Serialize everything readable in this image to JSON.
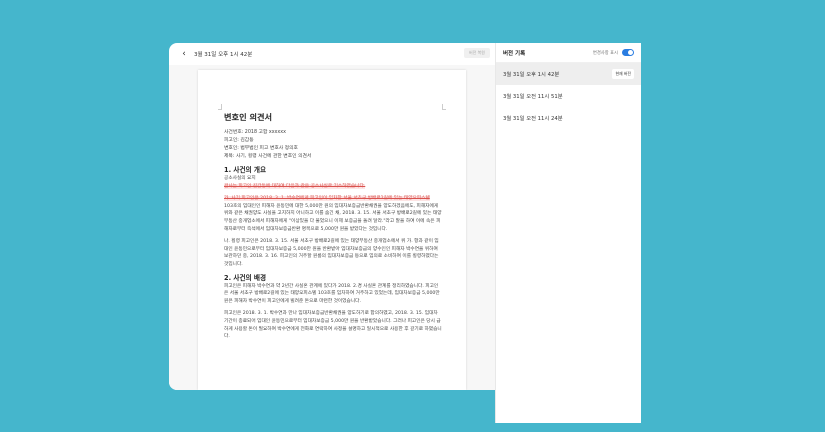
{
  "header": {
    "title": "3월 31일 오후 1시 42분",
    "back_icon": "chevron-left-icon",
    "restore_label": "버전 복원"
  },
  "document": {
    "title": "변호인 의견서",
    "meta": [
      "사건번호: 2018 고합 xxxxxx",
      "피고인: 김갑동",
      "변호인: 법무법인 피고 변호사 정의호",
      "제목: 사기, 횡령 사건에 관한 변호인 의견서"
    ],
    "section1_title": "1. 사건의 개요",
    "section1_sub": "공소사실의 요지",
    "section1_struck": "검사는 피고인 김갑동에 대하여 다음과 같은 공소사실로 기소하였습니다.",
    "para_a_struck": "가. 사기 피고인은 2018. 3. 1. 박수연에게 피고인이 임차한 서울 서초구 방배로2길에 있는 태양오피스텔",
    "para_a_rest": "103호의 임대인인 피해자 윤동민에 대한 5,000만 원의 임대차보증금반환채권을 양도하겠음에도, 피해자에게 위와 같은 채권양도 사실을 고지하지 아니하고 이를 숨긴 채, 2018. 3. 15. 서울 서초구 방배로2길에 있는 태양부동산 중개업소에서 피해자에게 \"이상있을 다 물었으니 이제 보증금을 돌려 달라.\"라고 말을 하여 이에 속은 피해자로부터 즉석에서 임대차보증금반환 명목으로 5,000만 원을 받았다는 것입니다.",
    "para_b": "나. 횡령 피고인은 2018. 3. 15. 서울 서초구 방배로2길에 있는 태양부동산 중개업소에서 위 가. 항과 같이 임대인 윤동민으로부터 임대차보증금 5,000만 원을 반환받아 임대차보증금의 양수인인 피해자 박수연을 위하여 보관하던 중, 2018. 3. 16. 피고인의 거주할 원룸의 임대차보증금 등으로 임의로 소비하여 이를 횡령하였다는 것입니다.",
    "section2_title": "2. 사건의 배경",
    "para_c": "피고인은 피해자 박수연과 약 2년간 사실혼 관계에 있다가 2018. 2.경 사실혼 관계를 정리하였습니다. 피고인은 서울 서초구 방배로2길에 있는 태양오피스텔 103호를 임차하여 거주하고 있었는데, 임대차보증금 5,000만 원은 피해자 박수연이 피고인에게 빌려준 돈으로 마련한 것이었습니다.",
    "para_d": "피고인은 2018. 3. 1. 박수연과 만나 임대차보증금반환채권을 양도하기로 합의하였고, 2018. 3. 15. 임대차기간이 종료되어 임대인 윤동민으로부터 임대차보증금 5,000만 원을 반환받았습니다. 그러나 피고인은 당시 급하게 사용할 돈이 필요하여 박수연에게 전화로 연락하여 사정을 설명하고 일시적으로 사용한 후 갚기로 하였습니다."
  },
  "panel": {
    "title": "버전 기록",
    "toggle_label": "변경사항 표시",
    "toggle_on": true,
    "accent_color": "#2a7de1",
    "versions": [
      {
        "label": "3월 31일 오후 1시 42분",
        "badge": "현재 버전"
      },
      {
        "label": "3월 31일 오전 11시 51분"
      },
      {
        "label": "3월 31일 오전 11시 24분"
      }
    ]
  }
}
